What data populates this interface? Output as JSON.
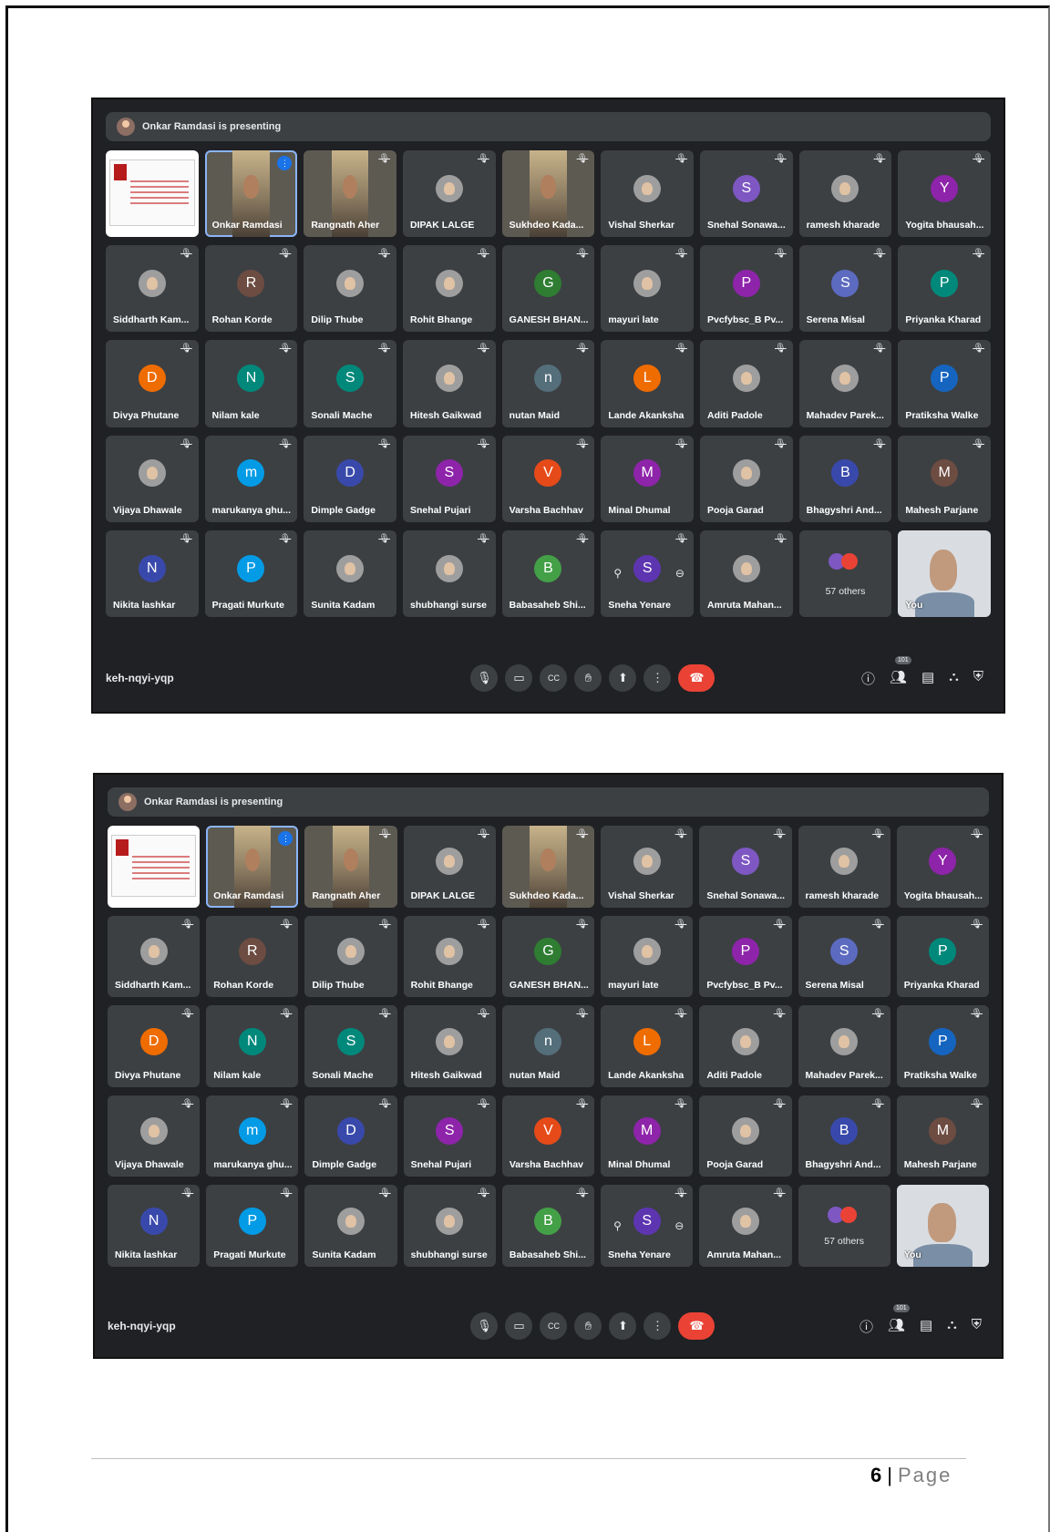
{
  "presenting_text": "Onkar Ramdasi is presenting",
  "meeting_code": "keh-nqyi-yqp",
  "participants_count": "101",
  "others_label": "57 others",
  "page_number": "6",
  "page_label": "Page",
  "colors": {
    "meet_bg": "#202124",
    "tile_bg": "#3c4043",
    "end_call": "#ea4335",
    "speaking": "#1a73e8"
  },
  "tiles": [
    {
      "name": "",
      "kind": "slide"
    },
    {
      "name": "Onkar Ramdasi",
      "kind": "video",
      "speaking": true
    },
    {
      "name": "Rangnath Aher",
      "kind": "video"
    },
    {
      "name": "DIPAK LALGE",
      "kind": "photo"
    },
    {
      "name": "Sukhdeo Kada...",
      "kind": "video"
    },
    {
      "name": "Vishal Sherkar",
      "kind": "photo"
    },
    {
      "name": "Snehal Sonawa...",
      "letter": "S",
      "color": "#7e57c2"
    },
    {
      "name": "ramesh kharade",
      "kind": "photo"
    },
    {
      "name": "Yogita bhausah...",
      "letter": "Y",
      "color": "#8e24aa"
    },
    {
      "name": "Siddharth Kam...",
      "kind": "photo"
    },
    {
      "name": "Rohan Korde",
      "letter": "R",
      "color": "#6d4c41"
    },
    {
      "name": "Dilip Thube",
      "kind": "photo"
    },
    {
      "name": "Rohit Bhange",
      "kind": "photo"
    },
    {
      "name": "GANESH BHAN...",
      "letter": "G",
      "color": "#2e7d32"
    },
    {
      "name": "mayuri late",
      "kind": "photo"
    },
    {
      "name": "Pvcfybsc_B Pv...",
      "letter": "P",
      "color": "#8e24aa"
    },
    {
      "name": "Serena Misal",
      "letter": "S",
      "color": "#5c6bc0"
    },
    {
      "name": "Priyanka Kharad",
      "letter": "P",
      "color": "#00897b"
    },
    {
      "name": "Divya Phutane",
      "letter": "D",
      "color": "#ef6c00"
    },
    {
      "name": "Nilam kale",
      "letter": "N",
      "color": "#00897b"
    },
    {
      "name": "Sonali Mache",
      "letter": "S",
      "color": "#00897b"
    },
    {
      "name": "Hitesh Gaikwad",
      "kind": "photo"
    },
    {
      "name": "nutan Maid",
      "letter": "n",
      "color": "#546e7a"
    },
    {
      "name": "Lande Akanksha",
      "letter": "L",
      "color": "#ef6c00"
    },
    {
      "name": "Aditi Padole",
      "kind": "photo"
    },
    {
      "name": "Mahadev Parek...",
      "kind": "photo"
    },
    {
      "name": "Pratiksha Walke",
      "letter": "P",
      "color": "#1565c0"
    },
    {
      "name": "Vijaya Dhawale",
      "kind": "photo"
    },
    {
      "name": "marukanya ghu...",
      "letter": "m",
      "color": "#039be5"
    },
    {
      "name": "Dimple Gadge",
      "letter": "D",
      "color": "#3949ab"
    },
    {
      "name": "Snehal Pujari",
      "letter": "S",
      "color": "#8e24aa"
    },
    {
      "name": "Varsha Bachhav",
      "letter": "V",
      "color": "#e64a19"
    },
    {
      "name": "Minal Dhumal",
      "letter": "M",
      "color": "#8e24aa"
    },
    {
      "name": "Pooja Garad",
      "kind": "photo"
    },
    {
      "name": "Bhagyshri And...",
      "letter": "B",
      "color": "#3949ab"
    },
    {
      "name": "Mahesh Parjane",
      "letter": "M",
      "color": "#6d4c41"
    },
    {
      "name": "Nikita lashkar",
      "letter": "N",
      "color": "#3949ab"
    },
    {
      "name": "Pragati Murkute",
      "letter": "P",
      "color": "#039be5"
    },
    {
      "name": "Sunita Kadam",
      "kind": "photo"
    },
    {
      "name": "shubhangi surse",
      "kind": "photo"
    },
    {
      "name": "Babasaheb Shi...",
      "letter": "B",
      "color": "#43a047"
    },
    {
      "name": "Sneha Yenare",
      "letter": "S",
      "color": "#5e35b1",
      "pinned": true
    },
    {
      "name": "Amruta Mahan...",
      "kind": "photo"
    },
    {
      "name": "",
      "kind": "others"
    },
    {
      "name": "You",
      "kind": "you"
    }
  ]
}
